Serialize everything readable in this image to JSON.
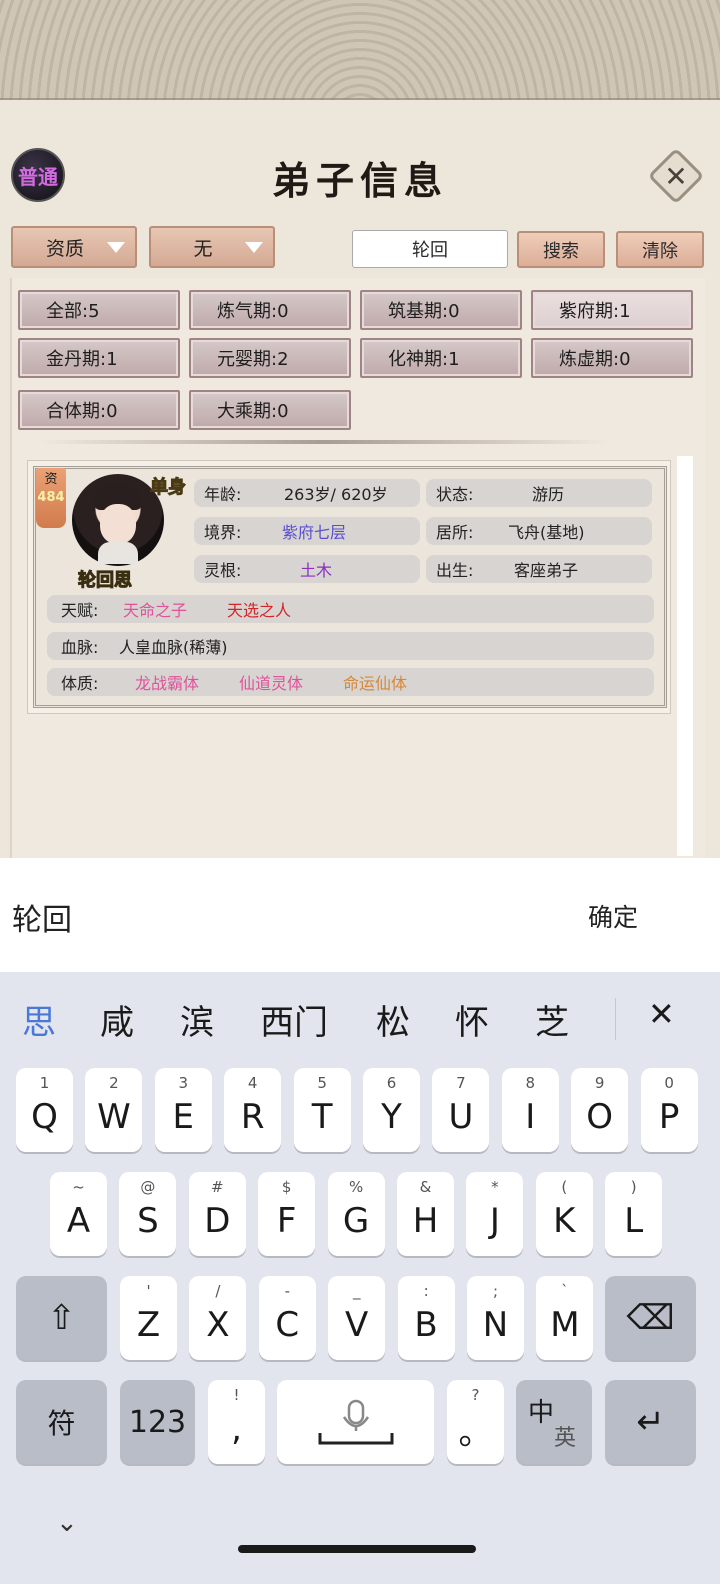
{
  "header": {
    "mode_badge": "普通",
    "title": "弟子信息",
    "close": "✕"
  },
  "filters": {
    "dropdown1": "资质",
    "dropdown2": "无",
    "search_value": "轮回",
    "search_button": "搜索",
    "clear_button": "清除"
  },
  "chips": [
    {
      "label": "全部:5"
    },
    {
      "label": "炼气期:0"
    },
    {
      "label": "筑基期:0"
    },
    {
      "label": "紫府期:1"
    },
    {
      "label": "金丹期:1"
    },
    {
      "label": "元婴期:2"
    },
    {
      "label": "化神期:1"
    },
    {
      "label": "炼虚期:0"
    },
    {
      "label": "合体期:0"
    },
    {
      "label": "大乘期:0"
    }
  ],
  "disciple": {
    "ribbon_label": "资",
    "ribbon_value": "484",
    "status_tag": "单身",
    "name": "轮回思",
    "age_label": "年龄:",
    "age_value": "263岁/ 620岁",
    "state_label": "状态:",
    "state_value": "游历",
    "realm_label": "境界:",
    "realm_value": "紫府七层",
    "residence_label": "居所:",
    "residence_value": "飞舟(基地)",
    "root_label": "灵根:",
    "root_value": "土木",
    "origin_label": "出生:",
    "origin_value": "客座弟子",
    "talent_label": "天赋:",
    "talent_1": "天命之子",
    "talent_2": "天选之人",
    "bloodline_label": "血脉:",
    "bloodline_value": "人皇血脉(稀薄)",
    "physique_label": "体质:",
    "physique_1": "龙战霸体",
    "physique_2": "仙道灵体",
    "physique_3": "命运仙体",
    "colors": {
      "realm": "#5b4fd0",
      "root": "#8a2fc0",
      "talent1": "#e0529a",
      "talent2": "#d2262a",
      "phys1": "#e0529a",
      "phys2": "#e0529a",
      "phys3": "#d4883a"
    }
  },
  "input_bar": {
    "text": "轮回",
    "confirm": "确定"
  },
  "keyboard": {
    "candidates": [
      "思",
      "咸",
      "滨",
      "西门",
      "松",
      "怀",
      "芝"
    ],
    "candidate_close": "✕",
    "row1": [
      [
        "1",
        "Q"
      ],
      [
        "2",
        "W"
      ],
      [
        "3",
        "E"
      ],
      [
        "4",
        "R"
      ],
      [
        "5",
        "T"
      ],
      [
        "6",
        "Y"
      ],
      [
        "7",
        "U"
      ],
      [
        "8",
        "I"
      ],
      [
        "9",
        "O"
      ],
      [
        "0",
        "P"
      ]
    ],
    "row2": [
      [
        "~",
        "A"
      ],
      [
        "@",
        "S"
      ],
      [
        "#",
        "D"
      ],
      [
        "$",
        "F"
      ],
      [
        "%",
        "G"
      ],
      [
        "&",
        "H"
      ],
      [
        "*",
        "J"
      ],
      [
        "(",
        "K"
      ],
      [
        ")",
        "L"
      ]
    ],
    "row3": [
      [
        "'",
        "Z"
      ],
      [
        "/",
        "X"
      ],
      [
        "-",
        "C"
      ],
      [
        "_",
        "V"
      ],
      [
        ":",
        "B"
      ],
      [
        ";",
        "N"
      ],
      [
        "`",
        "M"
      ]
    ],
    "shift": "⇧",
    "backspace": "⌫",
    "symbol_key": "符",
    "num_key": "123",
    "comma_sub": "!",
    "comma": ",",
    "period_sub": "?",
    "period": "。",
    "lang_main": "中",
    "lang_sub": "英",
    "enter": "↵",
    "collapse": "⌄"
  }
}
